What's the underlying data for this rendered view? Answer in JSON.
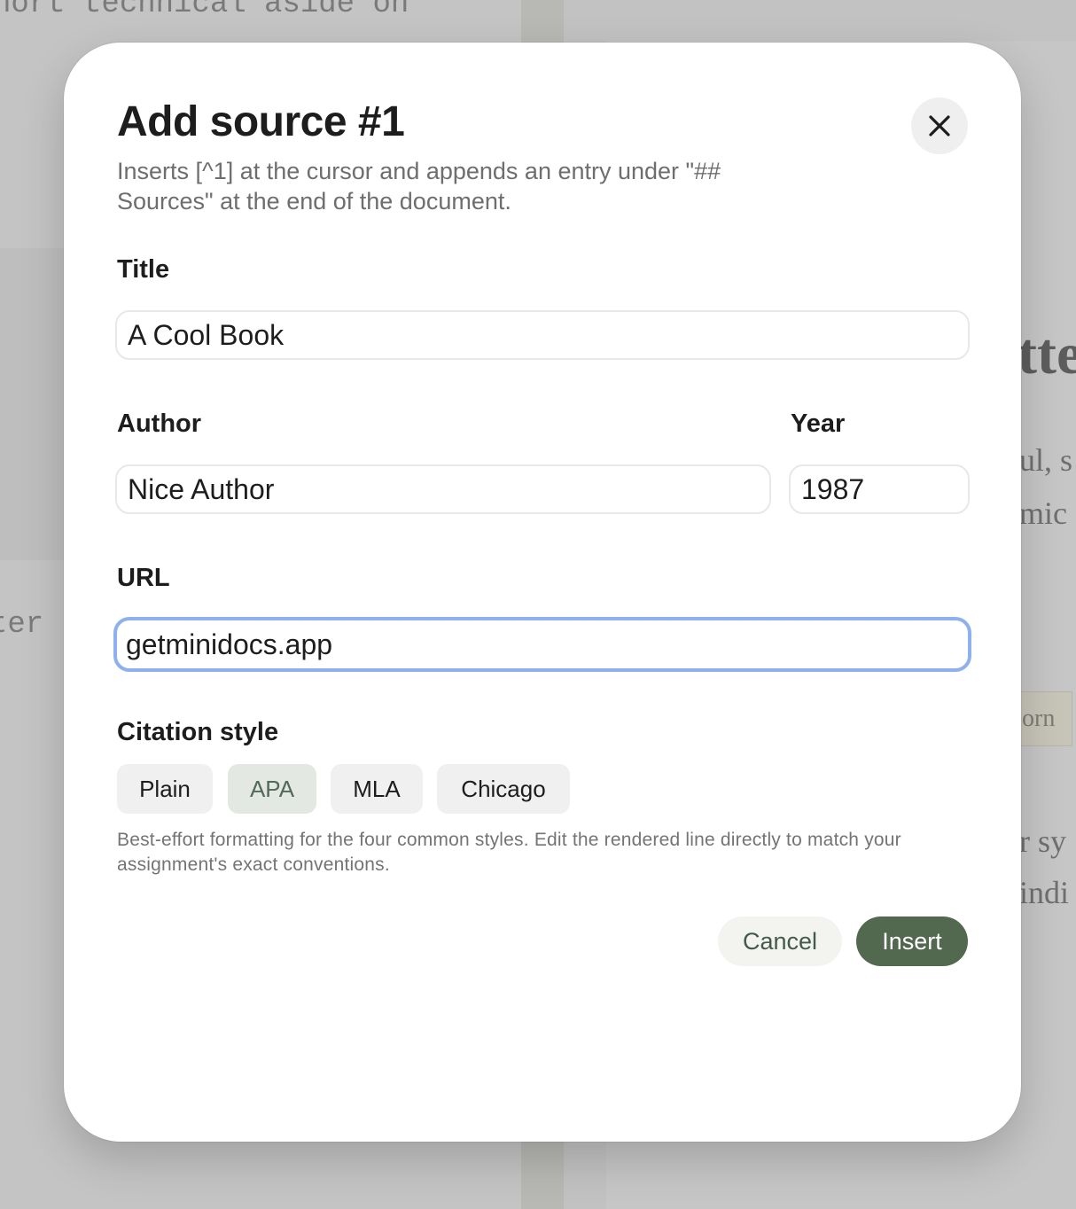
{
  "background": {
    "left_line_1": "hort technical aside on",
    "left_line_2": "ter",
    "right_heading": "tte",
    "right_line_1": "ul, s",
    "right_line_2": "mic",
    "right_chip": "orn",
    "right_line_3": "r sy",
    "right_line_4": "indi"
  },
  "dialog": {
    "title": "Add source #1",
    "subtitle": "Inserts [^1] at the cursor and appends an entry under \"## Sources\" at the end of the document.",
    "close_icon": "close-icon",
    "fields": {
      "title": {
        "label": "Title",
        "value": "A Cool Book"
      },
      "author": {
        "label": "Author",
        "value": "Nice Author"
      },
      "year": {
        "label": "Year",
        "value": "1987"
      },
      "url": {
        "label": "URL",
        "value": "getminidocs.app"
      }
    },
    "citation": {
      "label": "Citation style",
      "options": [
        "Plain",
        "APA",
        "MLA",
        "Chicago"
      ],
      "selected": "APA",
      "help": "Best-effort formatting for the four common styles. Edit the rendered line directly to match your assignment's exact conventions."
    },
    "actions": {
      "cancel": "Cancel",
      "insert": "Insert"
    }
  },
  "colors": {
    "accent": "#52684f",
    "focus_ring": "#8fb0ee",
    "selected_chip": "#e3e8e3"
  }
}
